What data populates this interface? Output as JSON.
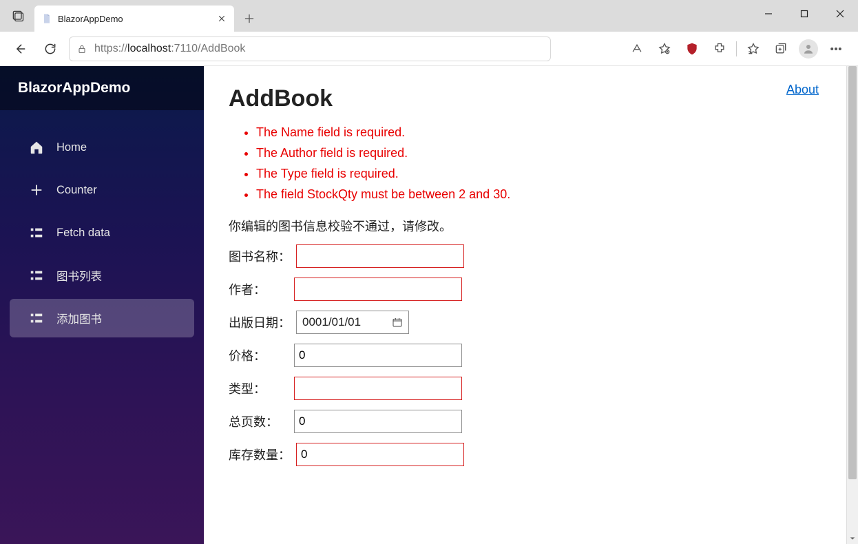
{
  "browser": {
    "tab_title": "BlazorAppDemo",
    "url_prefix": "https://",
    "url_host": "localhost",
    "url_port_path": ":7110/AddBook"
  },
  "sidebar": {
    "brand": "BlazorAppDemo",
    "items": [
      {
        "label": "Home"
      },
      {
        "label": "Counter"
      },
      {
        "label": "Fetch data"
      },
      {
        "label": "图书列表"
      },
      {
        "label": "添加图书"
      }
    ]
  },
  "top_link": "About",
  "page": {
    "title": "AddBook",
    "errors": [
      "The Name field is required.",
      "The Author field is required.",
      "The Type field is required.",
      "The field StockQty must be between 2 and 30."
    ],
    "message": "你编辑的图书信息校验不通过，请修改。",
    "fields": {
      "name": {
        "label": "图书名称：",
        "value": ""
      },
      "author": {
        "label": "作者：",
        "value": ""
      },
      "date": {
        "label": "出版日期：",
        "value": "0001/01/01"
      },
      "price": {
        "label": "价格：",
        "value": "0"
      },
      "type": {
        "label": "类型：",
        "value": ""
      },
      "pages": {
        "label": "总页数：",
        "value": "0"
      },
      "stock": {
        "label": "库存数量：",
        "value": "0"
      }
    }
  }
}
